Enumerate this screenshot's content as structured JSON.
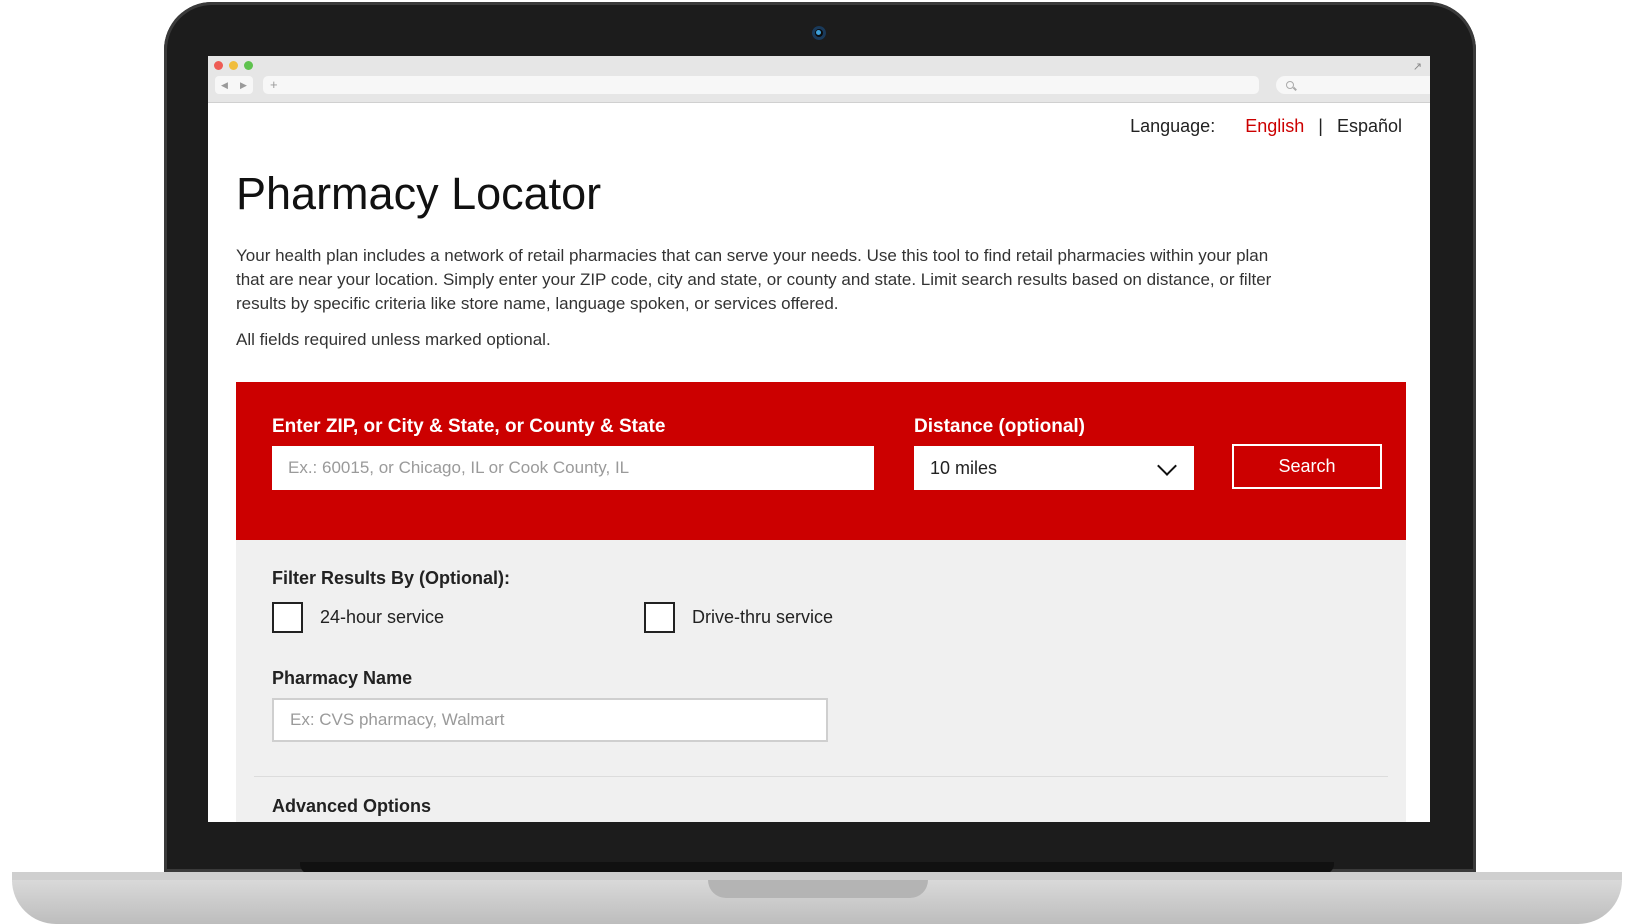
{
  "language": {
    "label": "Language:",
    "options": [
      "English",
      "Español"
    ],
    "separator": "|",
    "active": "English"
  },
  "page": {
    "title": "Pharmacy Locator",
    "intro": "Your health plan includes a network of retail pharmacies that can serve your needs. Use this tool to find retail pharmacies within your plan that are near your location. Simply enter your ZIP code, city and state, or county and state. Limit search results based on distance, or filter results by specific criteria like store name, language spoken, or services offered.",
    "required_note": "All fields required unless marked optional."
  },
  "search": {
    "location_label": "Enter ZIP, or City & State, or County & State",
    "location_placeholder": "Ex.: 60015, or Chicago, IL or Cook County, IL",
    "distance_label": "Distance (optional)",
    "distance_value": "10 miles",
    "button_label": "Search"
  },
  "filters": {
    "title": "Filter Results By (Optional):",
    "checkboxes": [
      {
        "label": "24-hour service",
        "checked": false
      },
      {
        "label": "Drive-thru service",
        "checked": false
      }
    ],
    "pharmacy_name_label": "Pharmacy Name",
    "pharmacy_name_placeholder": "Ex: CVS pharmacy, Walmart",
    "advanced_label": "Advanced Options"
  },
  "browser": {
    "new_tab": "+"
  },
  "colors": {
    "accent": "#cc0000",
    "panel_bg": "#f0f0f0"
  }
}
